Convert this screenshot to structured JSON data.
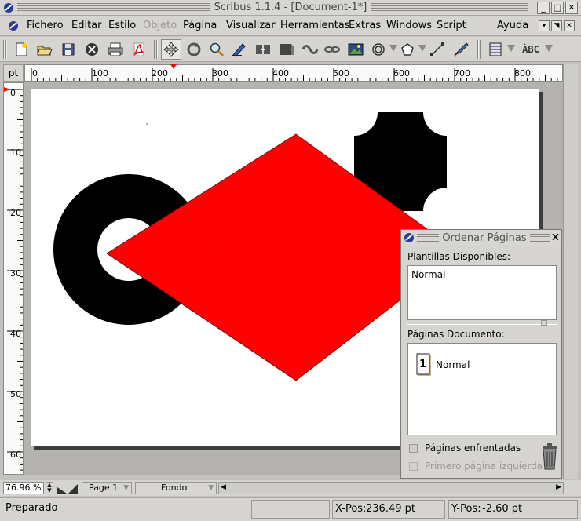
{
  "window": {
    "title": "Scribus 1.1.4 - [Document-1*]",
    "buttons": [
      "_",
      "□",
      "✕"
    ]
  },
  "menu": {
    "items": [
      {
        "label": "Fichero",
        "disabled": false
      },
      {
        "label": "Editar",
        "disabled": false
      },
      {
        "label": "Estilo",
        "disabled": false
      },
      {
        "label": "Objeto",
        "disabled": true
      },
      {
        "label": "Página",
        "disabled": false
      },
      {
        "label": "Visualizar",
        "disabled": false
      },
      {
        "label": "Herramientas",
        "disabled": false
      },
      {
        "label": "Extras",
        "disabled": false
      },
      {
        "label": "Windows",
        "disabled": false
      },
      {
        "label": "Script",
        "disabled": false
      },
      {
        "label": "Ayuda",
        "disabled": false
      }
    ]
  },
  "toolbar": {
    "icons": [
      "new-document-icon",
      "open-folder-icon",
      "save-icon",
      "close-icon",
      "print-icon",
      "pdf-icon",
      "move-icon",
      "rotate-icon",
      "zoom-icon",
      "edit-text-icon",
      "link-text-icon",
      "unlink-icon",
      "shape-icon",
      "chain-icon",
      "unchain-icon",
      "image-icon",
      "ellipse-icon",
      "polygon-icon",
      "line-icon",
      "bezier-icon",
      "table-icon",
      "spellcheck-icon"
    ],
    "spell_label": "ÀBC"
  },
  "ruler": {
    "unit": "pt",
    "h_labels": [
      "0",
      "100",
      "200",
      "300",
      "400",
      "500",
      "600",
      "700",
      "800"
    ],
    "v_labels": [
      "0",
      "10",
      "20",
      "30",
      "40",
      "50",
      "60"
    ]
  },
  "canvas": {
    "colors": {
      "diamond": "#ff0000",
      "shapes": "#000000",
      "page": "#ffffff",
      "desk": "#b4b2ae"
    }
  },
  "bottom": {
    "zoom": "76.96 %",
    "page": "Page 1",
    "layer": "Fondo"
  },
  "status": {
    "message": "Preparado",
    "xpos_label": "X-Pos:",
    "xpos_value": "236.49 pt",
    "ypos_label": "Y-Pos:",
    "ypos_value": "-2.60 pt"
  },
  "panel": {
    "title": "Ordenar Páginas",
    "templates_label": "Plantillas Disponibles:",
    "templates": [
      "Normal"
    ],
    "pages_label": "Páginas Documento:",
    "pages": [
      {
        "number": "1",
        "template": "Normal"
      }
    ],
    "facing_label": "Páginas enfrentadas",
    "first_left_label": "Primero página izquierda"
  }
}
